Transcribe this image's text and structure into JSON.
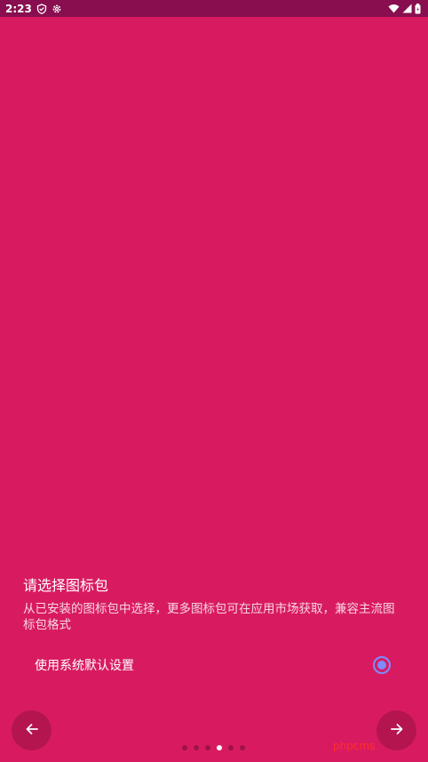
{
  "status_bar": {
    "time": "2:23"
  },
  "page": {
    "title": "请选择图标包",
    "description": "从已安装的图标包中选择，更多图标包可在应用市场获取，兼容主流图标包格式"
  },
  "option": {
    "label": "使用系统默认设置",
    "selected": true
  },
  "pager": {
    "total": 6,
    "active_index": 3
  },
  "watermark": "phpcms",
  "colors": {
    "background": "#d81b60",
    "status_bar": "#880e4f",
    "radio_accent": "#7c8cff"
  }
}
